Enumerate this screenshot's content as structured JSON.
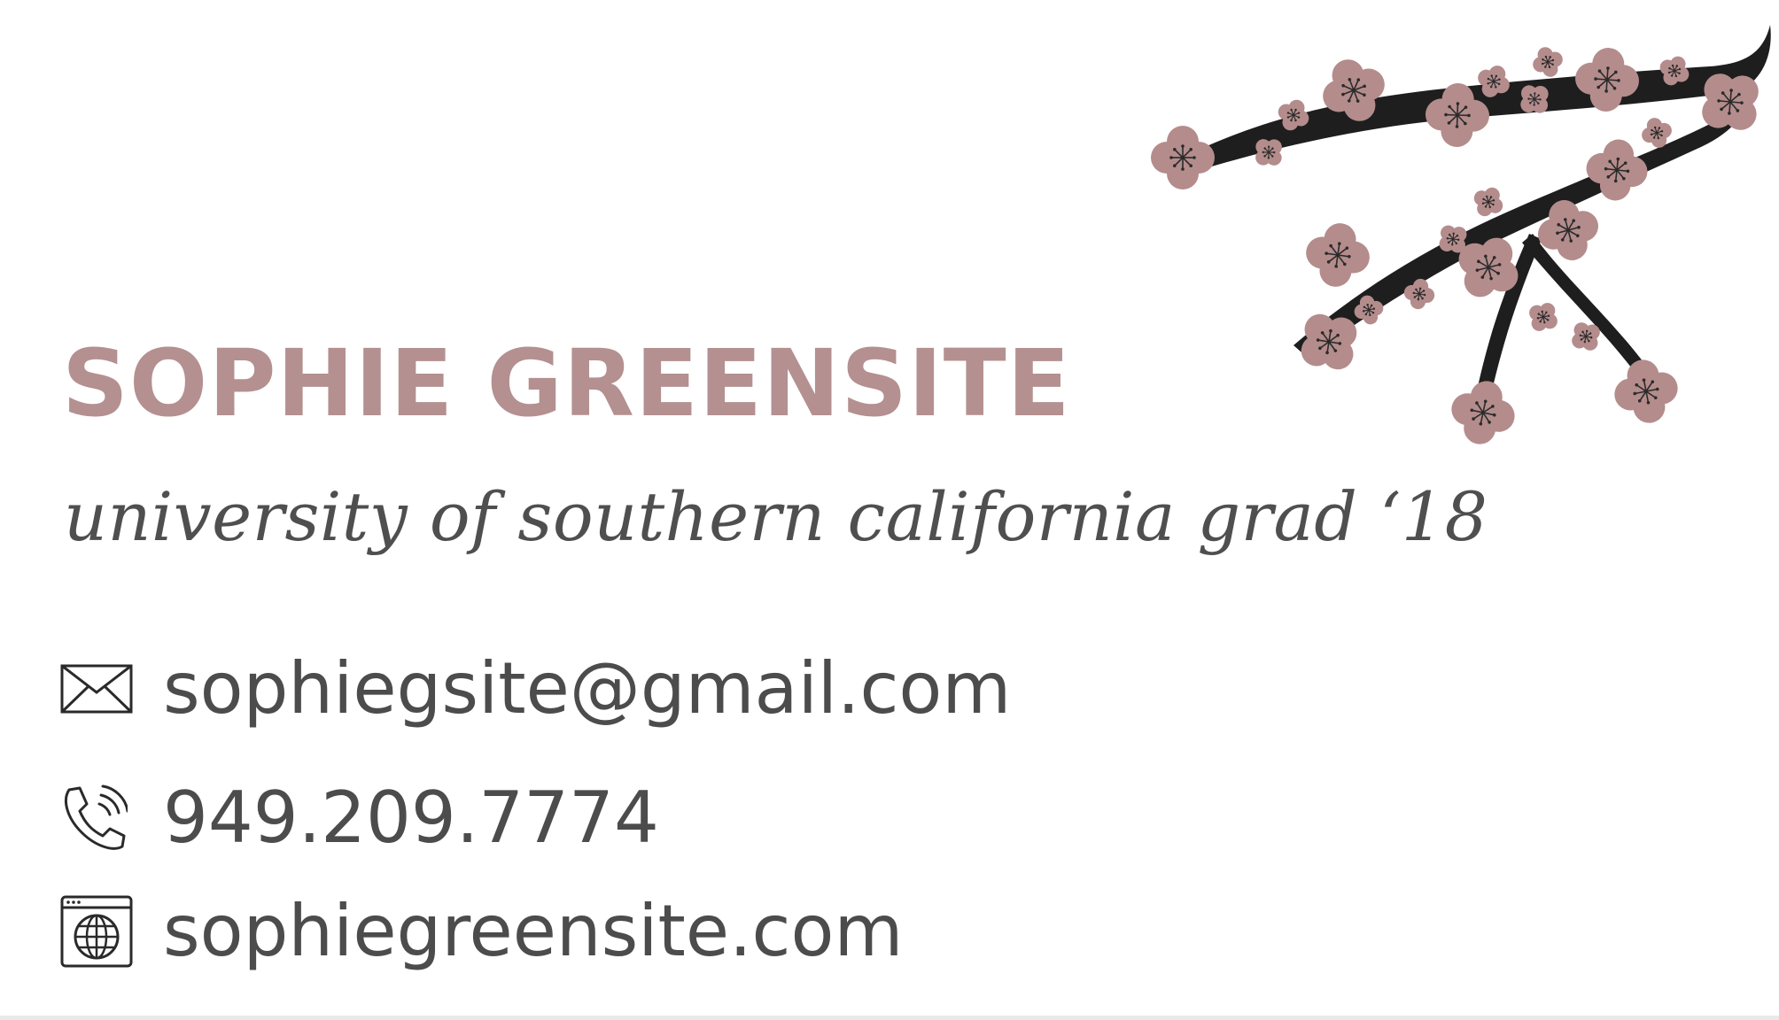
{
  "card": {
    "name": "SOPHIE GREENSITE",
    "tagline": "university of southern california grad ‘18",
    "contacts": {
      "email": "sophiegsite@gmail.com",
      "phone": "949.209.7774",
      "website": "sophiegreensite.com"
    }
  },
  "icons": {
    "email": "envelope-icon",
    "phone": "phone-icon",
    "website": "globe-window-icon"
  },
  "decoration": "cherry-blossom-branch-illustration",
  "colors": {
    "name": "#b49090",
    "text": "#4c4c4c",
    "blossom": "#b48c8c",
    "branch": "#1e1e1e",
    "background": "#ffffff"
  }
}
